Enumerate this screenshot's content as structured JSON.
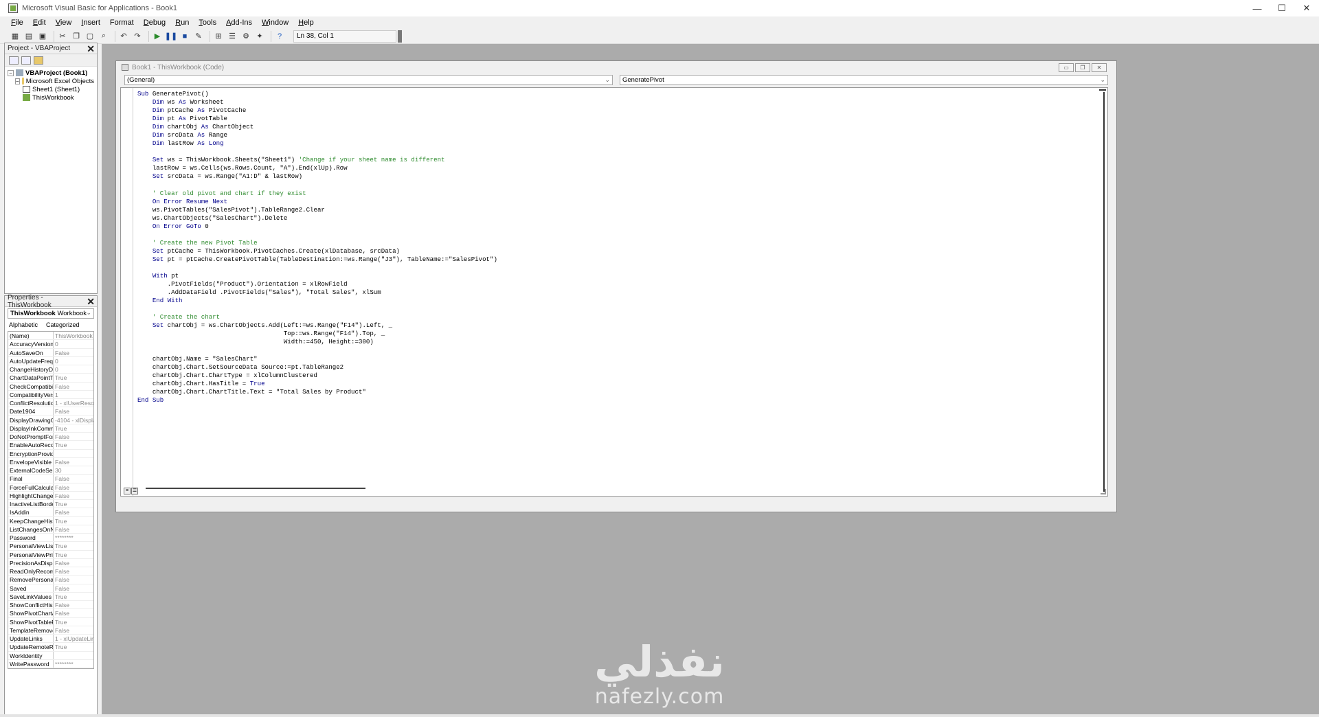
{
  "window": {
    "title": "Microsoft Visual Basic for Applications - Book1",
    "controls": [
      "—",
      "☐",
      "✕"
    ]
  },
  "menu": [
    {
      "label": "File",
      "acc": "F",
      "rest": "ile"
    },
    {
      "label": "Edit",
      "acc": "E",
      "rest": "dit"
    },
    {
      "label": "View",
      "acc": "V",
      "rest": "iew"
    },
    {
      "label": "Insert",
      "acc": "I",
      "rest": "nsert"
    },
    {
      "label": "Format",
      "acc": "",
      "rest": "Format"
    },
    {
      "label": "Debug",
      "acc": "D",
      "rest": "ebug"
    },
    {
      "label": "Run",
      "acc": "R",
      "rest": "un"
    },
    {
      "label": "Tools",
      "acc": "T",
      "rest": "ools"
    },
    {
      "label": "Add-Ins",
      "acc": "A",
      "rest": "dd-Ins"
    },
    {
      "label": "Window",
      "acc": "W",
      "rest": "indow"
    },
    {
      "label": "Help",
      "acc": "H",
      "rest": "elp"
    }
  ],
  "toolbar": {
    "status": "Ln 38, Col 1"
  },
  "project_panel": {
    "title": "Project - VBAProject",
    "tree": [
      {
        "label": "VBAProject (Book1)",
        "level": 0,
        "bold": true
      },
      {
        "label": "Microsoft Excel Objects",
        "level": 1,
        "bold": false
      },
      {
        "label": "Sheet1 (Sheet1)",
        "level": 2,
        "bold": false
      },
      {
        "label": "ThisWorkbook",
        "level": 2,
        "bold": false
      }
    ]
  },
  "properties_panel": {
    "title": "Properties - ThisWorkbook",
    "object_name": "ThisWorkbook",
    "object_type": "Workbook",
    "tabs": [
      "Alphabetic",
      "Categorized"
    ],
    "rows": [
      {
        "name": "(Name)",
        "value": "ThisWorkbook"
      },
      {
        "name": "AccuracyVersion",
        "value": "0"
      },
      {
        "name": "AutoSaveOn",
        "value": "False"
      },
      {
        "name": "AutoUpdateFrequ",
        "value": "0"
      },
      {
        "name": "ChangeHistoryDu",
        "value": "0"
      },
      {
        "name": "ChartDataPointTr",
        "value": "True"
      },
      {
        "name": "CheckCompatibilit",
        "value": "False"
      },
      {
        "name": "CompatibilityVersi",
        "value": "1"
      },
      {
        "name": "ConflictResolution",
        "value": "1 - xlUserResolu"
      },
      {
        "name": "Date1904",
        "value": "False"
      },
      {
        "name": "DisplayDrawingOb",
        "value": "-4104 - xlDisplay"
      },
      {
        "name": "DisplayInkComme",
        "value": "True"
      },
      {
        "name": "DoNotPromptForC",
        "value": "False"
      },
      {
        "name": "EnableAutoRecov",
        "value": "True"
      },
      {
        "name": "EncryptionProvide",
        "value": ""
      },
      {
        "name": "EnvelopeVisible",
        "value": "False"
      },
      {
        "name": "ExternalCodeServ",
        "value": "30"
      },
      {
        "name": "Final",
        "value": "False"
      },
      {
        "name": "ForceFullCalculati",
        "value": "False"
      },
      {
        "name": "HighlightChanges",
        "value": "False"
      },
      {
        "name": "InactiveListBorder",
        "value": "True"
      },
      {
        "name": "IsAddin",
        "value": "False"
      },
      {
        "name": "KeepChangeHisto",
        "value": "True"
      },
      {
        "name": "ListChangesOnNe",
        "value": "False"
      },
      {
        "name": "Password",
        "value": "********"
      },
      {
        "name": "PersonalViewListS",
        "value": "True"
      },
      {
        "name": "PersonalViewPrint",
        "value": "True"
      },
      {
        "name": "PrecisionAsDisplay",
        "value": "False"
      },
      {
        "name": "ReadOnlyRecomm",
        "value": "False"
      },
      {
        "name": "RemovePersonalIt",
        "value": "False"
      },
      {
        "name": "Saved",
        "value": "False"
      },
      {
        "name": "SaveLinkValues",
        "value": "True"
      },
      {
        "name": "ShowConflictHisto",
        "value": "False"
      },
      {
        "name": "ShowPivotChartA",
        "value": "False"
      },
      {
        "name": "ShowPivotTableFi",
        "value": "True"
      },
      {
        "name": "TemplateRemoved",
        "value": "False"
      },
      {
        "name": "UpdateLinks",
        "value": "1 - xlUpdateLink"
      },
      {
        "name": "UpdateRemoteRe",
        "value": "True"
      },
      {
        "name": "WorkIdentity",
        "value": ""
      },
      {
        "name": "WritePassword",
        "value": "********"
      }
    ]
  },
  "code_window": {
    "title": "Book1 - ThisWorkbook (Code)",
    "object_combo": "(General)",
    "procedure_combo": "GeneratePivot",
    "lines": [
      "Sub GeneratePivot()",
      "    Dim ws As Worksheet",
      "    Dim ptCache As PivotCache",
      "    Dim pt As PivotTable",
      "    Dim chartObj As ChartObject",
      "    Dim srcData As Range",
      "    Dim lastRow As Long",
      "",
      "    Set ws = ThisWorkbook.Sheets(\"Sheet1\") 'Change if your sheet name is different",
      "    lastRow = ws.Cells(ws.Rows.Count, \"A\").End(xlUp).Row",
      "    Set srcData = ws.Range(\"A1:D\" & lastRow)",
      "",
      "    ' Clear old pivot and chart if they exist",
      "    On Error Resume Next",
      "    ws.PivotTables(\"SalesPivot\").TableRange2.Clear",
      "    ws.ChartObjects(\"SalesChart\").Delete",
      "    On Error GoTo 0",
      "",
      "    ' Create the new Pivot Table",
      "    Set ptCache = ThisWorkbook.PivotCaches.Create(xlDatabase, srcData)",
      "    Set pt = ptCache.CreatePivotTable(TableDestination:=ws.Range(\"J3\"), TableName:=\"SalesPivot\")",
      "",
      "    With pt",
      "        .PivotFields(\"Product\").Orientation = xlRowField",
      "        .AddDataField .PivotFields(\"Sales\"), \"Total Sales\", xlSum",
      "    End With",
      "",
      "    ' Create the chart",
      "    Set chartObj = ws.ChartObjects.Add(Left:=ws.Range(\"F14\").Left, _",
      "                                       Top:=ws.Range(\"F14\").Top, _",
      "                                       Width:=450, Height:=300)",
      "",
      "    chartObj.Name = \"SalesChart\"",
      "    chartObj.Chart.SetSourceData Source:=pt.TableRange2",
      "    chartObj.Chart.ChartType = xlColumnClustered",
      "    chartObj.Chart.HasTitle = True",
      "    chartObj.Chart.ChartTitle.Text = \"Total Sales by Product\"",
      "End Sub"
    ]
  },
  "watermark": {
    "arabic": "نفذلي",
    "latin": "nafezly.com"
  },
  "colors": {
    "keyword": "#00008b",
    "comment": "#2e8b2e",
    "mdi_background": "#ababab"
  }
}
